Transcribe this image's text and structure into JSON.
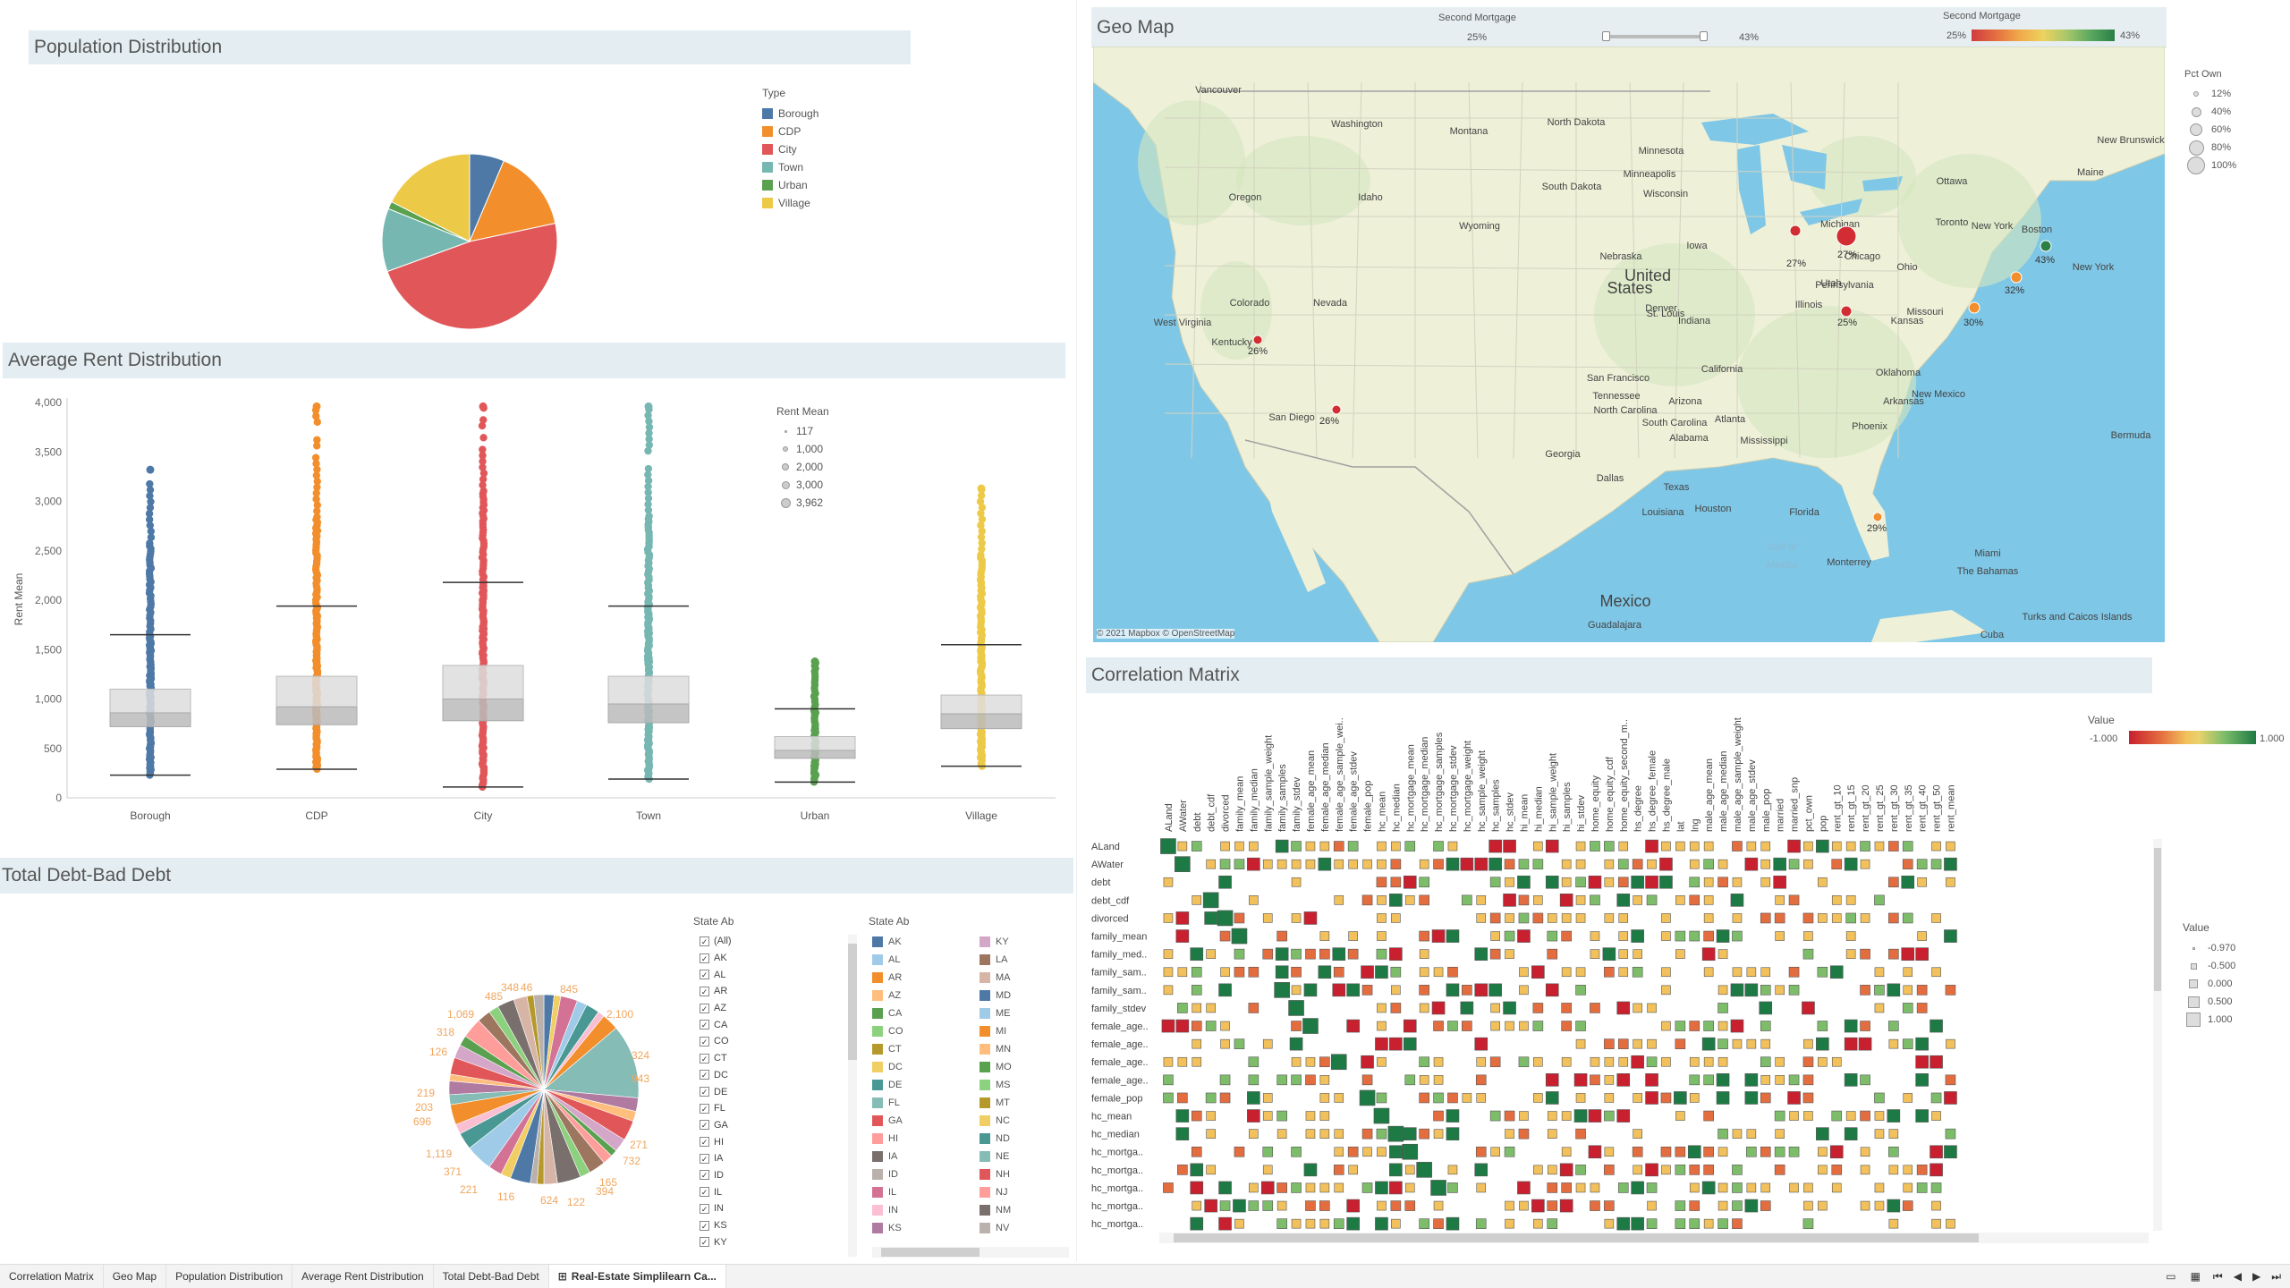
{
  "tabs": [
    {
      "label": "Correlation Matrix"
    },
    {
      "label": "Geo Map"
    },
    {
      "label": "Population Distribution"
    },
    {
      "label": "Average Rent Distribution"
    },
    {
      "label": "Total Debt-Bad Debt"
    },
    {
      "label": "Real-Estate Simplilearn Ca..."
    }
  ],
  "population": {
    "title": "Population Distribution",
    "legend_title": "Type",
    "types": [
      {
        "name": "Borough",
        "color": "#4e79a7"
      },
      {
        "name": "CDP",
        "color": "#f28e2b"
      },
      {
        "name": "City",
        "color": "#e15759"
      },
      {
        "name": "Town",
        "color": "#76b7b2"
      },
      {
        "name": "Urban",
        "color": "#59a14f"
      },
      {
        "name": "Village",
        "color": "#edc948"
      }
    ]
  },
  "rent": {
    "title": "Average Rent Distribution",
    "size_legend_title": "Rent Mean",
    "size_legend": [
      "117",
      "1,000",
      "2,000",
      "3,000",
      "3,962"
    ]
  },
  "debt": {
    "title": "Total Debt-Bad Debt",
    "pie_labels": [
      "348",
      "46",
      "845",
      "2,100",
      "485",
      "1,069",
      "318",
      "126",
      "324",
      "943",
      "219",
      "203",
      "696",
      "271",
      "732",
      "1,119",
      "371",
      "165",
      "221",
      "116",
      "122",
      "624",
      "394"
    ],
    "filter_title": "State Ab",
    "filter_items": [
      "(All)",
      "AK",
      "AL",
      "AR",
      "AZ",
      "CA",
      "CO",
      "CT",
      "DC",
      "DE",
      "FL",
      "GA",
      "HI",
      "IA",
      "ID",
      "IL",
      "IN",
      "KS",
      "KY"
    ],
    "legend_title": "State Ab",
    "legend_col1": [
      {
        "s": "AK",
        "c": "#4e79a7"
      },
      {
        "s": "AL",
        "c": "#a0cbe8"
      },
      {
        "s": "AR",
        "c": "#f28e2b"
      },
      {
        "s": "AZ",
        "c": "#ffbe7d"
      },
      {
        "s": "CA",
        "c": "#59a14f"
      },
      {
        "s": "CO",
        "c": "#8cd17d"
      },
      {
        "s": "CT",
        "c": "#b6992d"
      },
      {
        "s": "DC",
        "c": "#f1ce63"
      },
      {
        "s": "DE",
        "c": "#499894"
      },
      {
        "s": "FL",
        "c": "#86bcb6"
      },
      {
        "s": "GA",
        "c": "#e15759"
      },
      {
        "s": "HI",
        "c": "#ff9d9a"
      },
      {
        "s": "IA",
        "c": "#79706e"
      },
      {
        "s": "ID",
        "c": "#bab0ac"
      },
      {
        "s": "IL",
        "c": "#d37295"
      },
      {
        "s": "IN",
        "c": "#fabfd2"
      },
      {
        "s": "KS",
        "c": "#b07aa1"
      }
    ],
    "legend_col2": [
      {
        "s": "KY",
        "c": "#d4a6c8"
      },
      {
        "s": "LA",
        "c": "#9d7660"
      },
      {
        "s": "MA",
        "c": "#d7b5a6"
      },
      {
        "s": "MD",
        "c": "#4e79a7"
      },
      {
        "s": "ME",
        "c": "#a0cbe8"
      },
      {
        "s": "MI",
        "c": "#f28e2b"
      },
      {
        "s": "MN",
        "c": "#ffbe7d"
      },
      {
        "s": "MO",
        "c": "#59a14f"
      },
      {
        "s": "MS",
        "c": "#8cd17d"
      },
      {
        "s": "MT",
        "c": "#b6992d"
      },
      {
        "s": "NC",
        "c": "#f1ce63"
      },
      {
        "s": "ND",
        "c": "#499894"
      },
      {
        "s": "NE",
        "c": "#86bcb6"
      },
      {
        "s": "NH",
        "c": "#e15759"
      },
      {
        "s": "NJ",
        "c": "#ff9d9a"
      },
      {
        "s": "NM",
        "c": "#79706e"
      },
      {
        "s": "NV",
        "c": "#bab0ac"
      }
    ]
  },
  "geo": {
    "title": "Geo Map",
    "param_label": "Second Mortgage",
    "param_min": "25%",
    "param_max": "43%",
    "color_label": "Second Mortgage",
    "color_min": "25%",
    "color_max": "43%",
    "size_title": "Pct Own",
    "size_items": [
      "12%",
      "40%",
      "60%",
      "80%",
      "100%"
    ],
    "attribution": "© 2021 Mapbox © OpenStreetMap",
    "places": [
      {
        "t": "Vancouver"
      },
      {
        "t": "Washington"
      },
      {
        "t": "Montana"
      },
      {
        "t": "North Dakota"
      },
      {
        "t": "Minnesota"
      },
      {
        "t": "Minneapolis"
      },
      {
        "t": "Wisconsin"
      },
      {
        "t": "Ottawa"
      },
      {
        "t": "New Brunswick"
      },
      {
        "t": "Maine"
      },
      {
        "t": "Oregon"
      },
      {
        "t": "Idaho"
      },
      {
        "t": "Wyoming"
      },
      {
        "t": "South Dakota"
      },
      {
        "t": "Michigan"
      },
      {
        "t": "Toronto"
      },
      {
        "t": "New York"
      },
      {
        "t": "Boston"
      },
      {
        "t": "Iowa"
      },
      {
        "t": "Chicago"
      },
      {
        "t": "Nebraska"
      },
      {
        "t": "United"
      },
      {
        "t": "States"
      },
      {
        "t": "Denver"
      },
      {
        "t": "Colorado"
      },
      {
        "t": "Nevada"
      },
      {
        "t": "Utah"
      },
      {
        "t": "Ohio"
      },
      {
        "t": "Pennsylvania"
      },
      {
        "t": "Illinois"
      },
      {
        "t": "Indiana"
      },
      {
        "t": "St. Louis"
      },
      {
        "t": "Missouri"
      },
      {
        "t": "Kansas"
      },
      {
        "t": "West Virginia"
      },
      {
        "t": "Kentucky"
      },
      {
        "t": "San Francisco"
      },
      {
        "t": "California"
      },
      {
        "t": "Oklahoma"
      },
      {
        "t": "Tennessee"
      },
      {
        "t": "North Carolina"
      },
      {
        "t": "Arizona"
      },
      {
        "t": "New Mexico"
      },
      {
        "t": "Arkansas"
      },
      {
        "t": "Atlanta"
      },
      {
        "t": "South Carolina"
      },
      {
        "t": "Phoenix"
      },
      {
        "t": "Mississippi"
      },
      {
        "t": "Alabama"
      },
      {
        "t": "Georgia"
      },
      {
        "t": "Dallas"
      },
      {
        "t": "Texas"
      },
      {
        "t": "Louisiana"
      },
      {
        "t": "Houston"
      },
      {
        "t": "Florida"
      },
      {
        "t": "Miami"
      },
      {
        "t": "Monterrey"
      },
      {
        "t": "The Bahamas"
      },
      {
        "t": "Mexico"
      },
      {
        "t": "Gulf of"
      },
      {
        "t": "Mexico"
      },
      {
        "t": "Guadalajara"
      },
      {
        "t": "Cuba"
      },
      {
        "t": "Turks and Caicos Islands"
      },
      {
        "t": "Bermuda"
      },
      {
        "t": "San Diego"
      },
      {
        "t": "New York"
      }
    ],
    "markers": [
      {
        "label": "27%"
      },
      {
        "label": "27%"
      },
      {
        "label": "25%"
      },
      {
        "label": "43%"
      },
      {
        "label": "32%"
      },
      {
        "label": "30%"
      },
      {
        "label": "26%"
      },
      {
        "label": "26%"
      },
      {
        "label": "29%"
      }
    ]
  },
  "corr": {
    "title": "Correlation Matrix",
    "value_label": "Value",
    "value_min": "-1.000",
    "value_max": "1.000",
    "size_title": "Value",
    "size_items": [
      "-0.970",
      "-0.500",
      "0.000",
      "0.500",
      "1.000"
    ],
    "columns": [
      "ALand",
      "AWater",
      "debt",
      "debt_cdf",
      "divorced",
      "family_mean",
      "family_median",
      "family_sample_weight",
      "family_samples",
      "family_stdev",
      "female_age_mean",
      "female_age_median",
      "female_age_sample_wei..",
      "female_age_stdev",
      "female_pop",
      "hc_mean",
      "hc_median",
      "hc_mortgage_mean",
      "hc_mortgage_median",
      "hc_mortgage_samples",
      "hc_mortgage_stdev",
      "hc_mortgage_weight",
      "hc_sample_weight",
      "hc_samples",
      "hc_stdev",
      "hi_mean",
      "hi_median",
      "hi_sample_weight",
      "hi_samples",
      "hi_stdev",
      "home_equity",
      "home_equity_cdf",
      "home_equity_second_m..",
      "hs_degree",
      "hs_degree_female",
      "hs_degree_male",
      "lat",
      "lng",
      "male_age_mean",
      "male_age_median",
      "male_age_sample_weight",
      "male_age_stdev",
      "male_pop",
      "married",
      "married_snp",
      "pct_own",
      "pop",
      "rent_gt_10",
      "rent_gt_15",
      "rent_gt_20",
      "rent_gt_25",
      "rent_gt_30",
      "rent_gt_35",
      "rent_gt_40",
      "rent_gt_50",
      "rent_mean"
    ],
    "rows": [
      "ALand",
      "AWater",
      "debt",
      "debt_cdf",
      "divorced",
      "family_mean",
      "family_med..",
      "family_sam..",
      "family_sam..",
      "family_stdev",
      "female_age..",
      "female_age..",
      "female_age..",
      "female_age..",
      "female_pop",
      "hc_mean",
      "hc_median",
      "hc_mortga..",
      "hc_mortga..",
      "hc_mortga..",
      "hc_mortga..",
      "hc_mortga.."
    ]
  }
}
